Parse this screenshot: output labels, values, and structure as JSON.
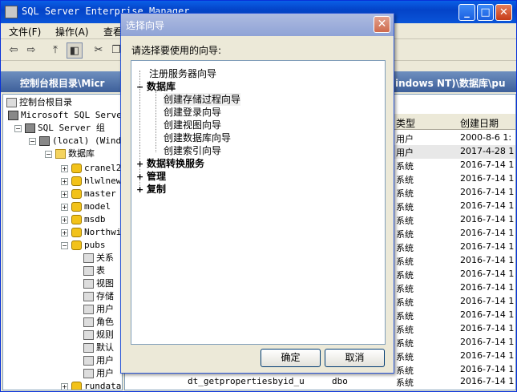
{
  "app": {
    "title": "SQL Server Enterprise Manager",
    "controls": {
      "minimize": "_",
      "maximize": "□",
      "close": "✕"
    }
  },
  "menubar": [
    "文件(F)",
    "操作(A)",
    "查看"
  ],
  "path": {
    "left": "控制台根目录\\Micr",
    "right": "indows NT)\\数据库\\pu"
  },
  "tree": {
    "items": [
      {
        "label": "控制台根目录",
        "level": 0,
        "icon": "console-icon"
      },
      {
        "label": "Microsoft SQL Server",
        "level": 1,
        "icon": "server-group-icon"
      },
      {
        "label": "SQL Server 组",
        "level": 2,
        "icon": "server-group-icon"
      },
      {
        "label": "(local) (Wind",
        "level": 3,
        "icon": "server-icon"
      },
      {
        "label": "数据库",
        "level": 4,
        "icon": "folder-icon"
      },
      {
        "label": "cranel2",
        "level": 5,
        "icon": "database-icon"
      },
      {
        "label": "hlwlnew",
        "level": 5,
        "icon": "database-icon"
      },
      {
        "label": "master",
        "level": 5,
        "icon": "database-icon"
      },
      {
        "label": "model",
        "level": 5,
        "icon": "database-icon"
      },
      {
        "label": "msdb",
        "level": 5,
        "icon": "database-icon"
      },
      {
        "label": "Northwi",
        "level": 5,
        "icon": "database-icon"
      },
      {
        "label": "pubs",
        "level": 5,
        "icon": "database-icon"
      },
      {
        "label": "关系",
        "level": 6,
        "icon": "diagram-icon"
      },
      {
        "label": "表",
        "level": 6,
        "icon": "table-icon"
      },
      {
        "label": "视图",
        "level": 6,
        "icon": "view-icon"
      },
      {
        "label": "存储",
        "level": 6,
        "icon": "stored-proc-icon"
      },
      {
        "label": "用户",
        "level": 6,
        "icon": "user-icon"
      },
      {
        "label": "角色",
        "level": 6,
        "icon": "role-icon"
      },
      {
        "label": "规则",
        "level": 6,
        "icon": "rule-icon"
      },
      {
        "label": "默认",
        "level": 6,
        "icon": "default-icon"
      },
      {
        "label": "用户",
        "level": 6,
        "icon": "user-icon"
      },
      {
        "label": "用户",
        "level": 6,
        "icon": "user-icon"
      },
      {
        "label": "rundata",
        "level": 5,
        "icon": "database-icon"
      }
    ]
  },
  "list": {
    "headers": {
      "type": "类型",
      "date": "创建日期"
    },
    "rows": [
      {
        "type": "用户",
        "date": "2000-8-6 1:"
      },
      {
        "type": "用户",
        "date": "2017-4-28 1"
      },
      {
        "type": "系统",
        "date": "2016-7-14 1"
      },
      {
        "type": "系统",
        "date": "2016-7-14 1"
      },
      {
        "type": "系统",
        "date": "2016-7-14 1"
      },
      {
        "type": "系统",
        "date": "2016-7-14 1"
      },
      {
        "type": "系统",
        "date": "2016-7-14 1"
      },
      {
        "type": "系统",
        "date": "2016-7-14 1"
      },
      {
        "type": "系统",
        "date": "2016-7-14 1"
      },
      {
        "type": "系统",
        "date": "2016-7-14 1"
      },
      {
        "type": "系统",
        "date": "2016-7-14 1"
      },
      {
        "type": "系统",
        "date": "2016-7-14 1"
      },
      {
        "type": "系统",
        "date": "2016-7-14 1"
      },
      {
        "type": "系统",
        "date": "2016-7-14 1"
      },
      {
        "type": "系统",
        "date": "2016-7-14 1"
      },
      {
        "type": "系统",
        "date": "2016-7-14 1"
      },
      {
        "type": "系统",
        "date": "2016-7-14 1"
      },
      {
        "type": "系统",
        "date": "2016-7-14 1"
      }
    ],
    "last_row": {
      "name": "dt_getpropertiesbyid_u",
      "owner": "dbo",
      "type": "系统",
      "date": "2016-7-14 1"
    }
  },
  "dialog": {
    "title": "选择向导",
    "prompt": "请选择要使用的向导:",
    "tree": [
      {
        "label": "注册服务器向导",
        "bold": false,
        "exp": ""
      },
      {
        "label": "数据库",
        "bold": true,
        "exp": "−"
      },
      {
        "label": "创建存储过程向导",
        "bold": false,
        "exp": "",
        "selected": true
      },
      {
        "label": "创建登录向导",
        "bold": false,
        "exp": ""
      },
      {
        "label": "创建视图向导",
        "bold": false,
        "exp": ""
      },
      {
        "label": "创建数据库向导",
        "bold": false,
        "exp": ""
      },
      {
        "label": "创建索引向导",
        "bold": false,
        "exp": ""
      },
      {
        "label": "数据转换服务",
        "bold": true,
        "exp": "+"
      },
      {
        "label": "管理",
        "bold": true,
        "exp": "+"
      },
      {
        "label": "复制",
        "bold": true,
        "exp": "+"
      }
    ],
    "ok": "确定",
    "cancel": "取消",
    "close": "✕"
  }
}
